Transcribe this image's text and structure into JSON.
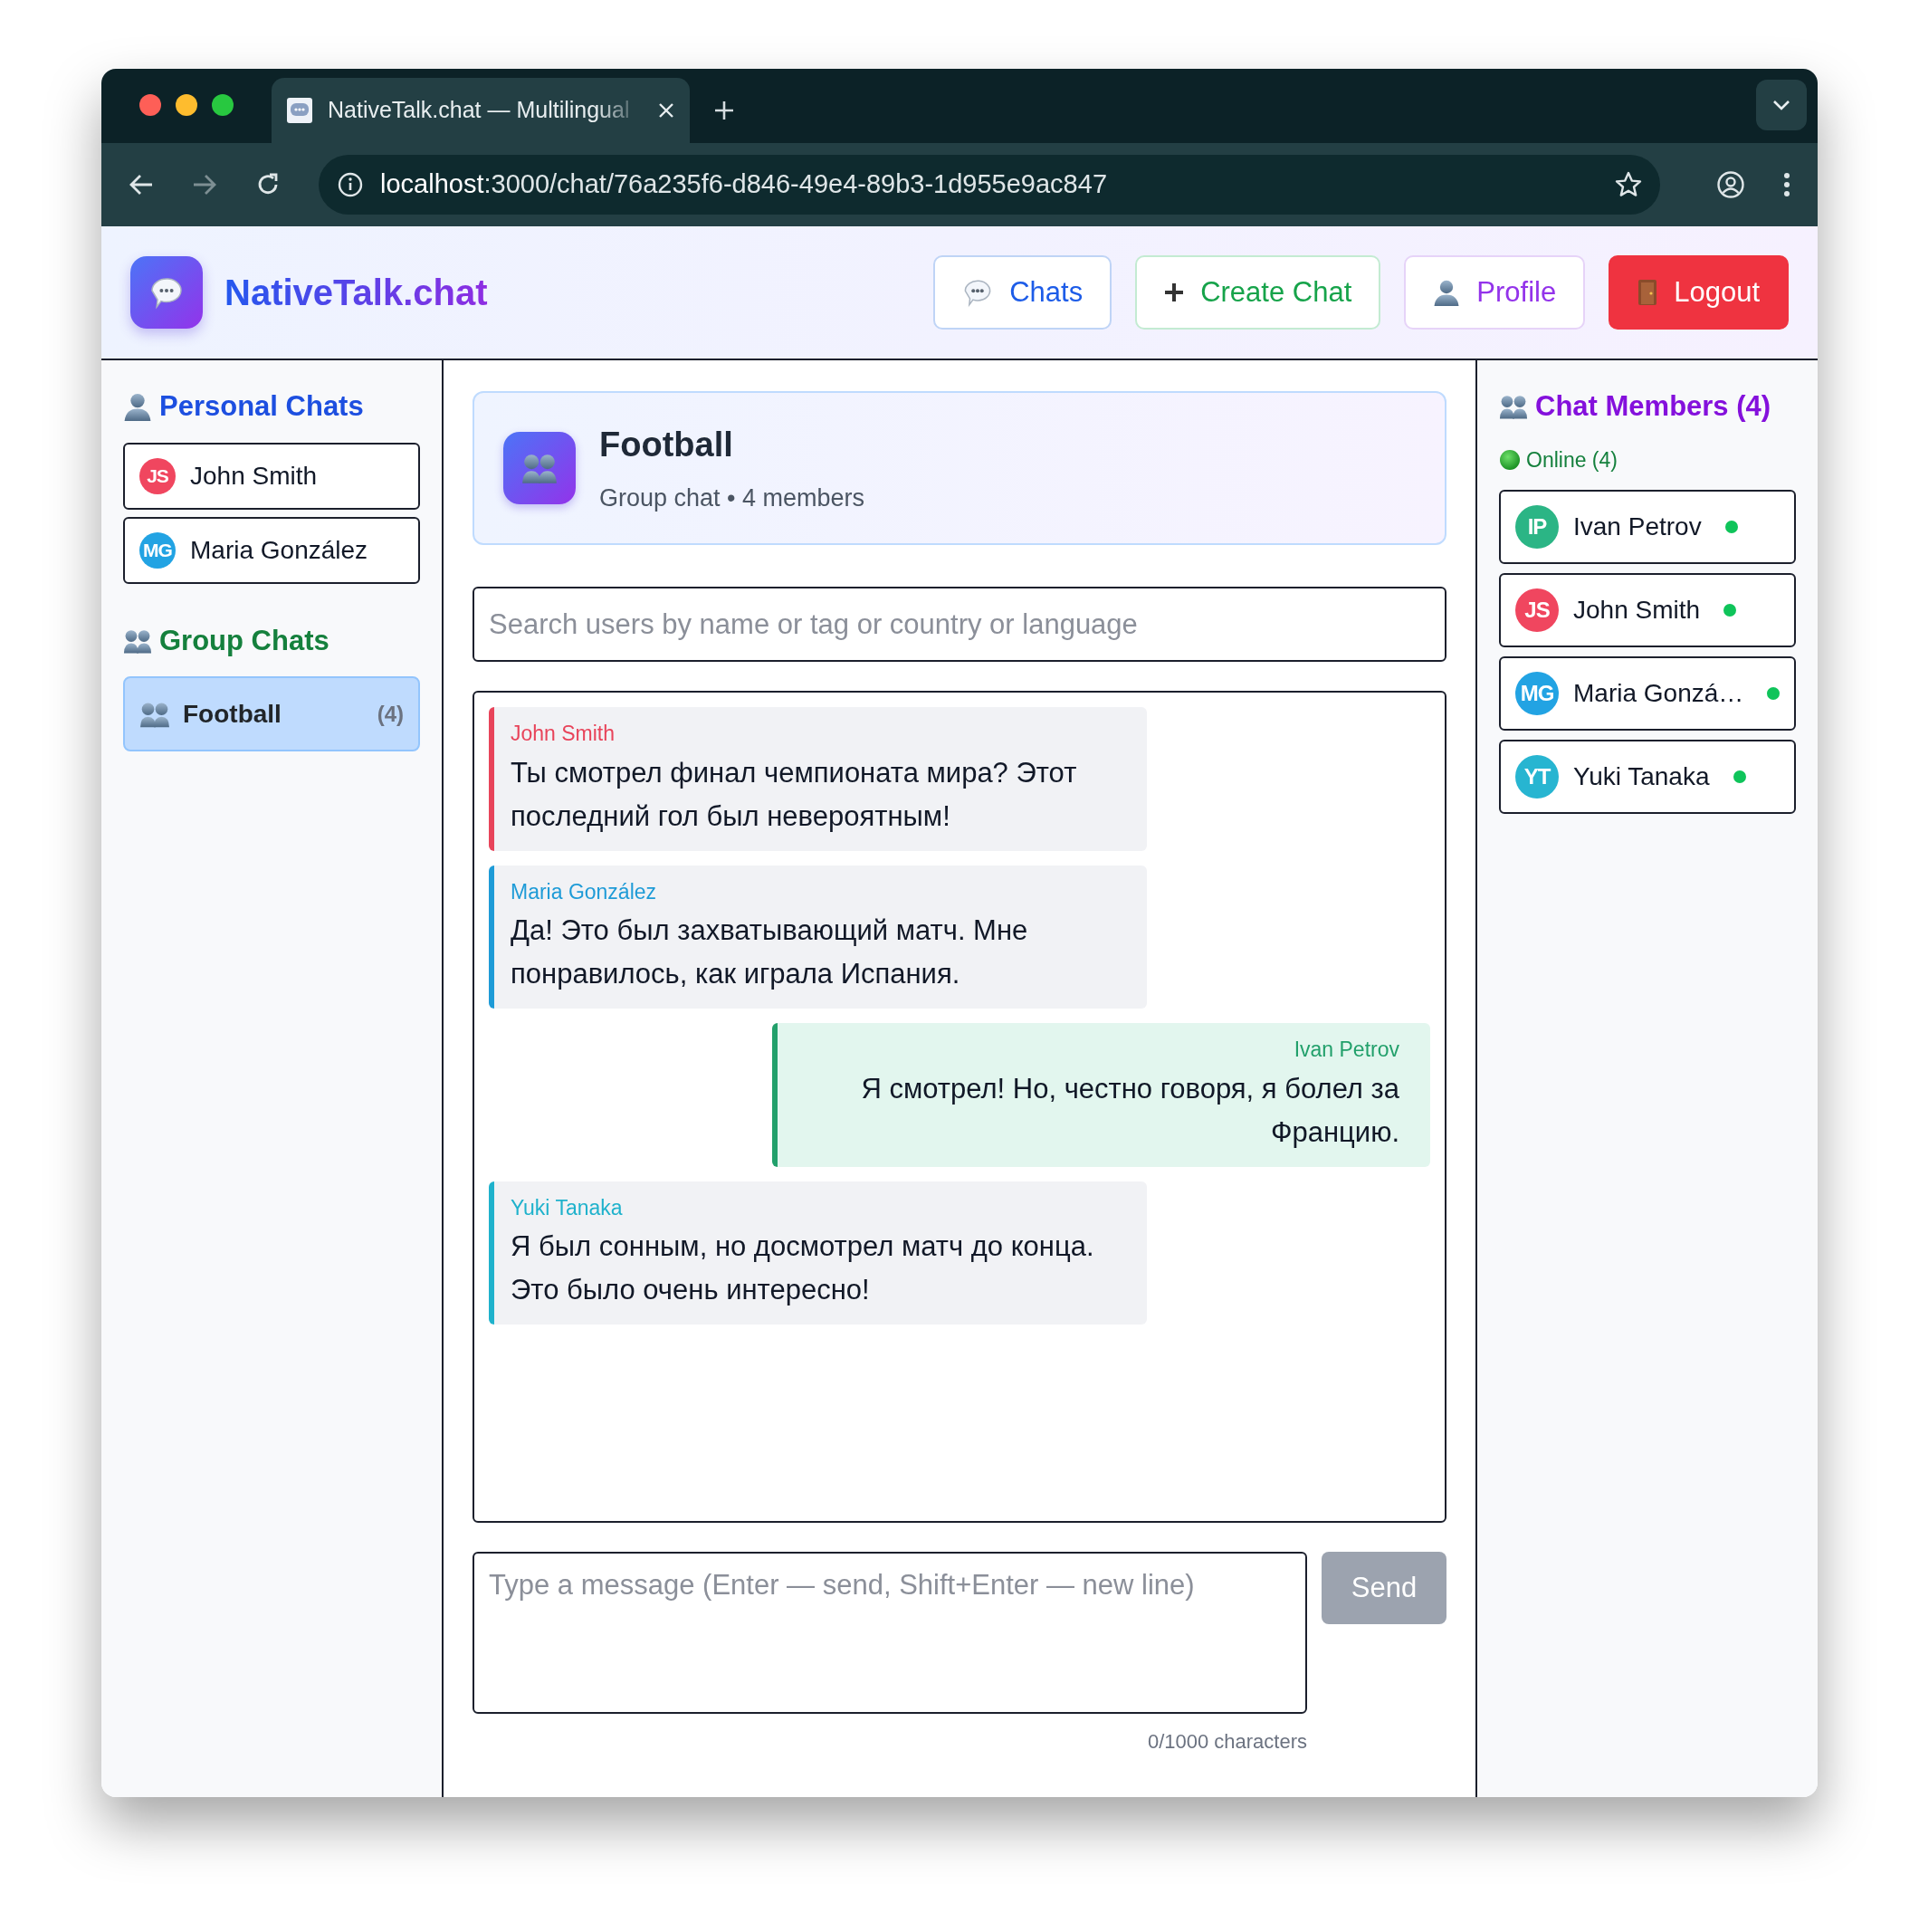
{
  "browser": {
    "tab_title": "NativeTalk.chat — Multilingual",
    "url_host": "localhost",
    "url_path": ":3000/chat/76a235f6-d846-49e4-89b3-1d955e9ac847"
  },
  "app": {
    "brand": "NativeTalk.chat",
    "nav": [
      {
        "label": "Chats",
        "kind": "chats"
      },
      {
        "label": "Create Chat",
        "kind": "create"
      },
      {
        "label": "Profile",
        "kind": "profile"
      },
      {
        "label": "Logout",
        "kind": "logout"
      }
    ]
  },
  "sidebar": {
    "personal_heading": "Personal Chats",
    "personal_chats": [
      {
        "initials": "JS",
        "name": "John Smith",
        "color": "#f0465f",
        "selected": false
      },
      {
        "initials": "MG",
        "name": "Maria González",
        "color": "#22a3e3",
        "selected": false
      }
    ],
    "group_heading": "Group Chats",
    "group_chats": [
      {
        "name": "Football",
        "count": "(4)",
        "selected": true
      }
    ]
  },
  "chat_header": {
    "title": "Football",
    "subtitle": "Group chat • 4 members"
  },
  "search": {
    "placeholder": "Search users by name or tag or country or language"
  },
  "messages": [
    {
      "sender": "John Smith",
      "text": "Ты смотрел финал чемпионата мира? Этот последний гол был невероятным!",
      "color": "#e8445a",
      "own": false
    },
    {
      "sender": "Maria González",
      "text": "Да! Это был захватывающий матч. Мне понравилось, как играла Испания.",
      "color": "#1e9bd7",
      "own": false
    },
    {
      "sender": "Ivan Petrov",
      "text": "Я смотрел! Но, честно говоря, я болел за Францию.",
      "color": "#22a06b",
      "own": true
    },
    {
      "sender": "Yuki Tanaka",
      "text": "Я был сонным, но досмотрел матч до конца. Это было очень интересно!",
      "color": "#1fb2cc",
      "own": false
    }
  ],
  "composer": {
    "placeholder": "Type a message (Enter — send, Shift+Enter — new line)",
    "send_label": "Send",
    "disabled": true,
    "counter": "0/1000 characters"
  },
  "members": {
    "heading": "Chat Members (4)",
    "online_label": "Online (4)",
    "items": [
      {
        "initials": "IP",
        "name": "Ivan Petrov",
        "color": "#2bb585",
        "online": true
      },
      {
        "initials": "JS",
        "name": "John Smith",
        "color": "#f0465f",
        "online": true
      },
      {
        "initials": "MG",
        "name": "Maria Gonzá…",
        "color": "#22a3e3",
        "online": true
      },
      {
        "initials": "YT",
        "name": "Yuki Tanaka",
        "color": "#27b5d1",
        "online": true
      }
    ]
  }
}
